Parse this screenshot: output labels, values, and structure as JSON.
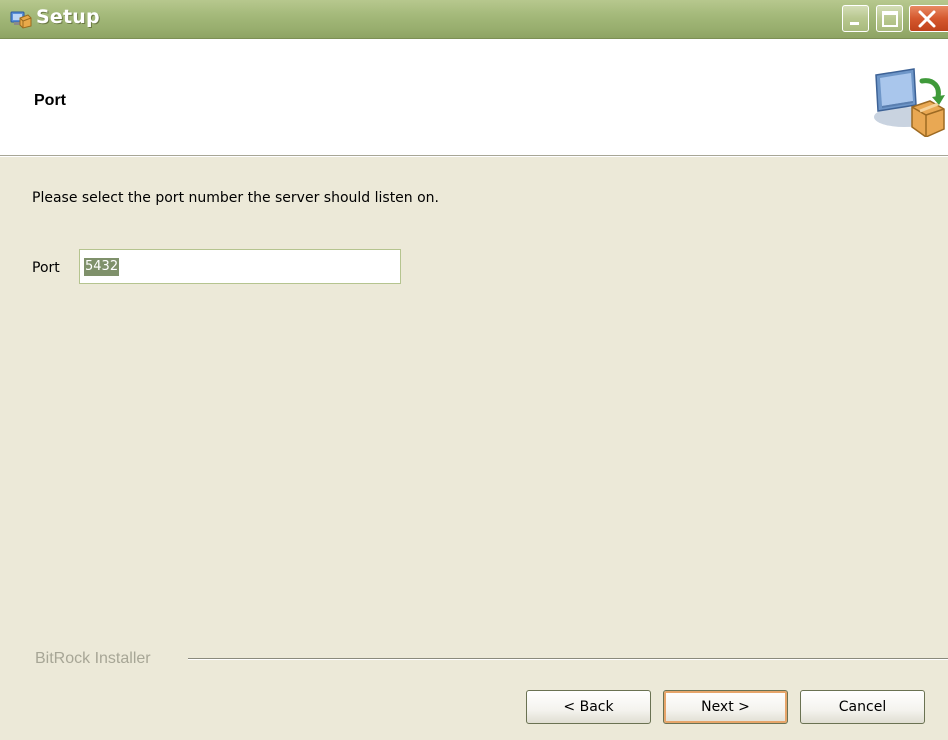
{
  "window": {
    "title": "Setup"
  },
  "header": {
    "title": "Port"
  },
  "content": {
    "instruction": "Please select the port number the server should listen on.",
    "port_label": "Port",
    "port_value": "5432"
  },
  "footer": {
    "branding": "BitRock Installer",
    "back_label": "< Back",
    "next_label": "Next >",
    "cancel_label": "Cancel"
  },
  "icons": {
    "title_icon": "installer-icon",
    "header_icon": "computer-package-icon",
    "minimize": "minimize-icon",
    "maximize": "maximize-icon",
    "close": "close-icon"
  },
  "colors": {
    "titlebar": "#a4b97a",
    "close_button": "#d5582e",
    "dialog_background": "#ece9d8",
    "selection": "#7f916b",
    "default_button_focus": "#e6a56a"
  }
}
